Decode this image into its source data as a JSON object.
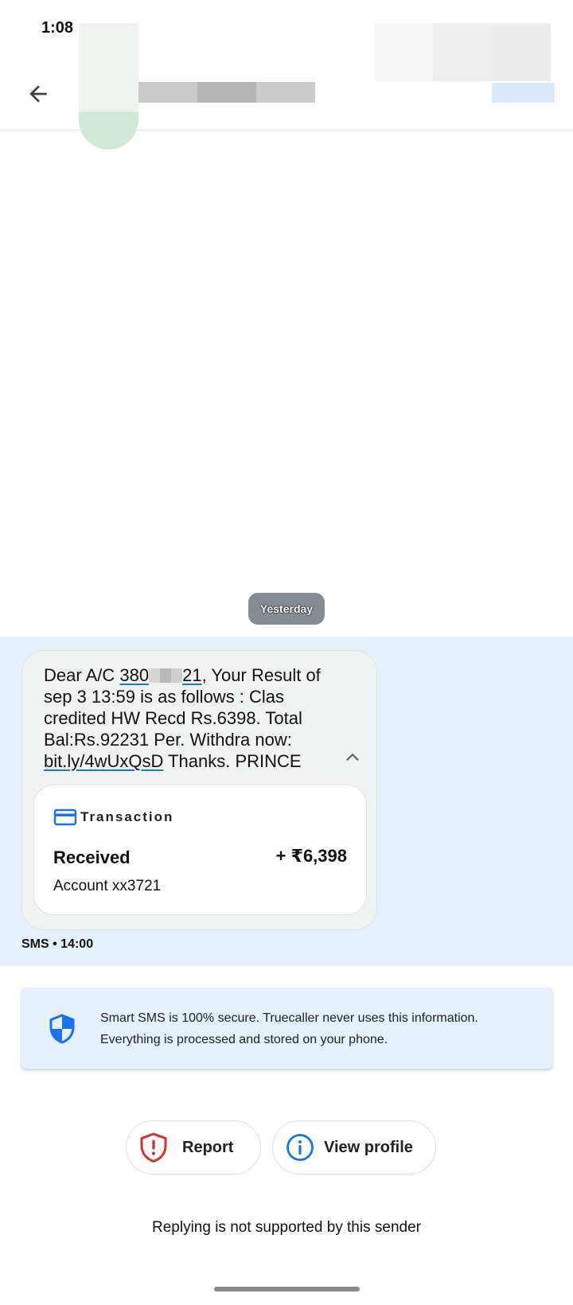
{
  "status_bar": {
    "time": "1:08"
  },
  "message": {
    "date_chip": "Yesterday",
    "text_prefix": "Dear A/C ",
    "account_start": "380",
    "account_end": "21",
    "text_body": ", Your Result of sep 3 13:59 is as follows : Clas credited HW Recd Rs.6398. Total Bal:Rs.92231 Per. Withdra now: ",
    "link": "bit.ly/4wUxQsD",
    "text_suffix": " Thanks. PRINCE",
    "meta": "SMS • 14:00"
  },
  "transaction": {
    "header": "Transaction",
    "status": "Received",
    "amount": "+ ₹6,398",
    "account": "Account xx3721"
  },
  "secure_notice": {
    "text": "Smart SMS is 100% secure. Truecaller never uses this information. Everything is processed and stored on your phone."
  },
  "actions": {
    "report_label": "Report",
    "view_profile_label": "View profile"
  },
  "footer": {
    "reply_note": "Replying is not supported by this sender"
  },
  "colors": {
    "accent_blue": "#1a73e8",
    "report_red": "#d93025",
    "message_background": "#e6effc"
  },
  "icons": {
    "back": "arrow-left-icon",
    "collapse": "chevron-up-icon",
    "transaction": "credit-card-icon",
    "secure": "shield-icon",
    "report": "shield-alert-icon",
    "profile": "info-icon"
  }
}
